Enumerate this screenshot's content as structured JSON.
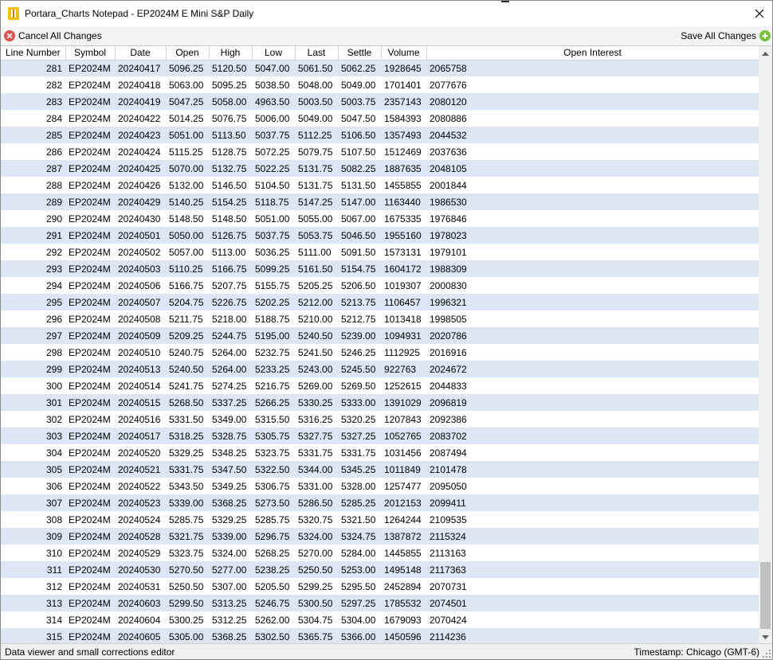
{
  "window": {
    "title": "Portara_Charts Notepad - EP2024M E Mini S&P Daily",
    "close_label": "close"
  },
  "toolbar": {
    "cancel_label": "Cancel All Changes",
    "save_label": "Save All Changes"
  },
  "colors": {
    "row_alt": "#dce6f4",
    "cancel_icon": "#d9534f",
    "save_icon": "#7ac142",
    "app_icon": "#f2c200"
  },
  "table": {
    "columns": [
      "Line Number",
      "Symbol",
      "Date",
      "Open",
      "High",
      "Low",
      "Last",
      "Settle",
      "Volume",
      "Open Interest"
    ],
    "rows": [
      [
        "281",
        "EP2024M",
        "20240417",
        "5096.25",
        "5120.50",
        "5047.00",
        "5061.50",
        "5062.25",
        "1928645",
        "2065758"
      ],
      [
        "282",
        "EP2024M",
        "20240418",
        "5063.00",
        "5095.25",
        "5038.50",
        "5048.00",
        "5049.00",
        "1701401",
        "2077676"
      ],
      [
        "283",
        "EP2024M",
        "20240419",
        "5047.25",
        "5058.00",
        "4963.50",
        "5003.50",
        "5003.75",
        "2357143",
        "2080120"
      ],
      [
        "284",
        "EP2024M",
        "20240422",
        "5014.25",
        "5076.75",
        "5006.00",
        "5049.00",
        "5047.50",
        "1584393",
        "2080886"
      ],
      [
        "285",
        "EP2024M",
        "20240423",
        "5051.00",
        "5113.50",
        "5037.75",
        "5112.25",
        "5106.50",
        "1357493",
        "2044532"
      ],
      [
        "286",
        "EP2024M",
        "20240424",
        "5115.25",
        "5128.75",
        "5072.25",
        "5079.75",
        "5107.50",
        "1512469",
        "2037636"
      ],
      [
        "287",
        "EP2024M",
        "20240425",
        "5070.00",
        "5132.75",
        "5022.25",
        "5131.75",
        "5082.25",
        "1887635",
        "2048105"
      ],
      [
        "288",
        "EP2024M",
        "20240426",
        "5132.00",
        "5146.50",
        "5104.50",
        "5131.75",
        "5131.50",
        "1455855",
        "2001844"
      ],
      [
        "289",
        "EP2024M",
        "20240429",
        "5140.25",
        "5154.25",
        "5118.75",
        "5147.25",
        "5147.00",
        "1163440",
        "1986530"
      ],
      [
        "290",
        "EP2024M",
        "20240430",
        "5148.50",
        "5148.50",
        "5051.00",
        "5055.00",
        "5067.00",
        "1675335",
        "1976846"
      ],
      [
        "291",
        "EP2024M",
        "20240501",
        "5050.00",
        "5126.75",
        "5037.75",
        "5053.75",
        "5046.50",
        "1955160",
        "1978023"
      ],
      [
        "292",
        "EP2024M",
        "20240502",
        "5057.00",
        "5113.00",
        "5036.25",
        "5111.00",
        "5091.50",
        "1573131",
        "1979101"
      ],
      [
        "293",
        "EP2024M",
        "20240503",
        "5110.25",
        "5166.75",
        "5099.25",
        "5161.50",
        "5154.75",
        "1604172",
        "1988309"
      ],
      [
        "294",
        "EP2024M",
        "20240506",
        "5166.75",
        "5207.75",
        "5155.75",
        "5205.25",
        "5206.50",
        "1019307",
        "2000830"
      ],
      [
        "295",
        "EP2024M",
        "20240507",
        "5204.75",
        "5226.75",
        "5202.25",
        "5212.00",
        "5213.75",
        "1106457",
        "1996321"
      ],
      [
        "296",
        "EP2024M",
        "20240508",
        "5211.75",
        "5218.00",
        "5188.75",
        "5210.00",
        "5212.75",
        "1013418",
        "1998505"
      ],
      [
        "297",
        "EP2024M",
        "20240509",
        "5209.25",
        "5244.75",
        "5195.00",
        "5240.50",
        "5239.00",
        "1094931",
        "2020786"
      ],
      [
        "298",
        "EP2024M",
        "20240510",
        "5240.75",
        "5264.00",
        "5232.75",
        "5241.50",
        "5246.25",
        "1112925",
        "2016916"
      ],
      [
        "299",
        "EP2024M",
        "20240513",
        "5240.50",
        "5264.00",
        "5233.25",
        "5243.00",
        "5245.50",
        "922763",
        "2024672"
      ],
      [
        "300",
        "EP2024M",
        "20240514",
        "5241.75",
        "5274.25",
        "5216.75",
        "5269.00",
        "5269.50",
        "1252615",
        "2044833"
      ],
      [
        "301",
        "EP2024M",
        "20240515",
        "5268.50",
        "5337.25",
        "5266.25",
        "5330.25",
        "5333.00",
        "1391029",
        "2096819"
      ],
      [
        "302",
        "EP2024M",
        "20240516",
        "5331.50",
        "5349.00",
        "5315.50",
        "5316.25",
        "5320.25",
        "1207843",
        "2092386"
      ],
      [
        "303",
        "EP2024M",
        "20240517",
        "5318.25",
        "5328.75",
        "5305.75",
        "5327.75",
        "5327.25",
        "1052765",
        "2083702"
      ],
      [
        "304",
        "EP2024M",
        "20240520",
        "5329.25",
        "5348.25",
        "5323.75",
        "5331.75",
        "5331.75",
        "1031456",
        "2087494"
      ],
      [
        "305",
        "EP2024M",
        "20240521",
        "5331.75",
        "5347.50",
        "5322.50",
        "5344.00",
        "5345.25",
        "1011849",
        "2101478"
      ],
      [
        "306",
        "EP2024M",
        "20240522",
        "5343.50",
        "5349.25",
        "5306.75",
        "5331.00",
        "5328.00",
        "1257477",
        "2095050"
      ],
      [
        "307",
        "EP2024M",
        "20240523",
        "5339.00",
        "5368.25",
        "5273.50",
        "5286.50",
        "5285.25",
        "2012153",
        "2099411"
      ],
      [
        "308",
        "EP2024M",
        "20240524",
        "5285.75",
        "5329.25",
        "5285.75",
        "5320.75",
        "5321.50",
        "1264244",
        "2109535"
      ],
      [
        "309",
        "EP2024M",
        "20240528",
        "5321.75",
        "5339.00",
        "5296.75",
        "5324.00",
        "5324.75",
        "1387872",
        "2115324"
      ],
      [
        "310",
        "EP2024M",
        "20240529",
        "5323.75",
        "5324.00",
        "5268.25",
        "5270.00",
        "5284.00",
        "1445855",
        "2113163"
      ],
      [
        "311",
        "EP2024M",
        "20240530",
        "5270.50",
        "5277.00",
        "5238.25",
        "5250.50",
        "5253.00",
        "1495148",
        "2117363"
      ],
      [
        "312",
        "EP2024M",
        "20240531",
        "5250.50",
        "5307.00",
        "5205.50",
        "5299.25",
        "5295.50",
        "2452894",
        "2070731"
      ],
      [
        "313",
        "EP2024M",
        "20240603",
        "5299.50",
        "5313.25",
        "5246.75",
        "5300.50",
        "5297.25",
        "1785532",
        "2074501"
      ],
      [
        "314",
        "EP2024M",
        "20240604",
        "5300.25",
        "5312.25",
        "5262.00",
        "5304.75",
        "5304.00",
        "1679093",
        "2070424"
      ],
      [
        "315",
        "EP2024M",
        "20240605",
        "5305.00",
        "5368.25",
        "5302.50",
        "5365.75",
        "5366.00",
        "1450596",
        "2114236"
      ]
    ]
  },
  "status": {
    "left": "Data viewer and small corrections editor",
    "right": "Timestamp: Chicago (GMT-6)"
  }
}
